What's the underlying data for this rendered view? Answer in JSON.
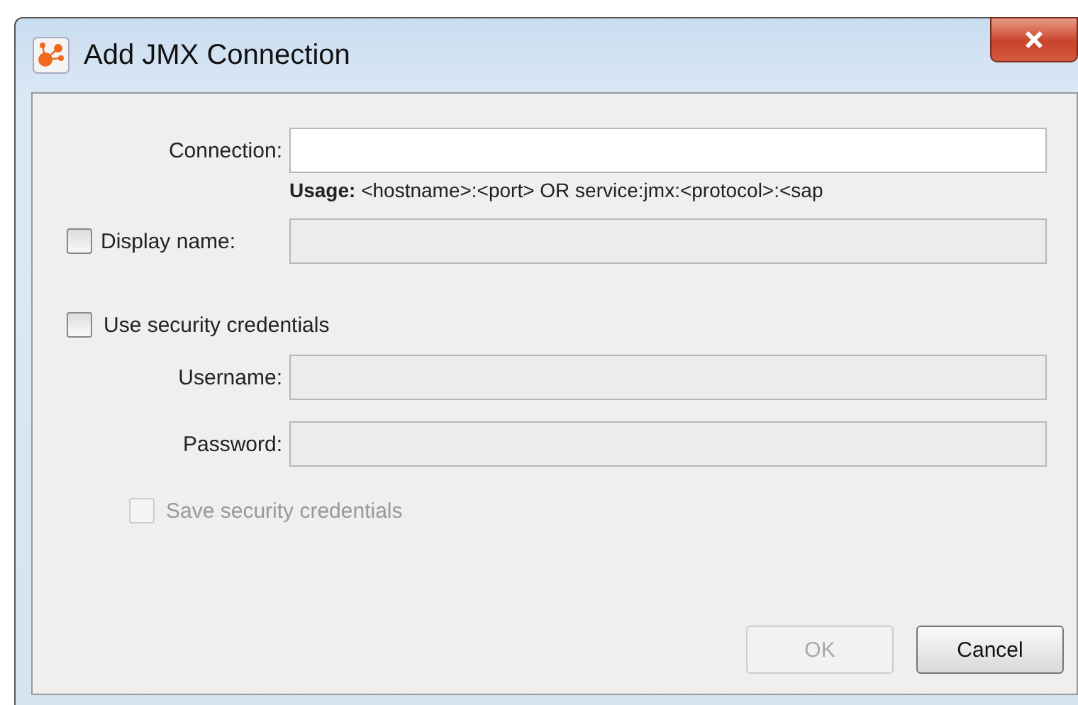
{
  "window": {
    "title": "Add JMX Connection"
  },
  "connection": {
    "label": "Connection:",
    "disabled": false,
    "usage": "**Usage:** <hostname>:<port> OR service:jmx:<protocol>:<sap"
  },
  "display_name": {
    "label": "Display name:",
    "checked": false,
    "disabled": true
  },
  "use_security": {
    "label": "Use security credentials",
    "checked": false,
    "disabled": false
  },
  "credentials": [
    {
      "label": "Username:",
      "disabled": true
    },
    {
      "label": "Password:",
      "disabled": true
    }
  ],
  "save_credentials": {
    "label": "Save security credentials",
    "checked": false,
    "disabled": true
  },
  "buttons": [
    {
      "label": "OK",
      "disabled": true
    },
    {
      "label": "Cancel",
      "disabled": false
    }
  ]
}
